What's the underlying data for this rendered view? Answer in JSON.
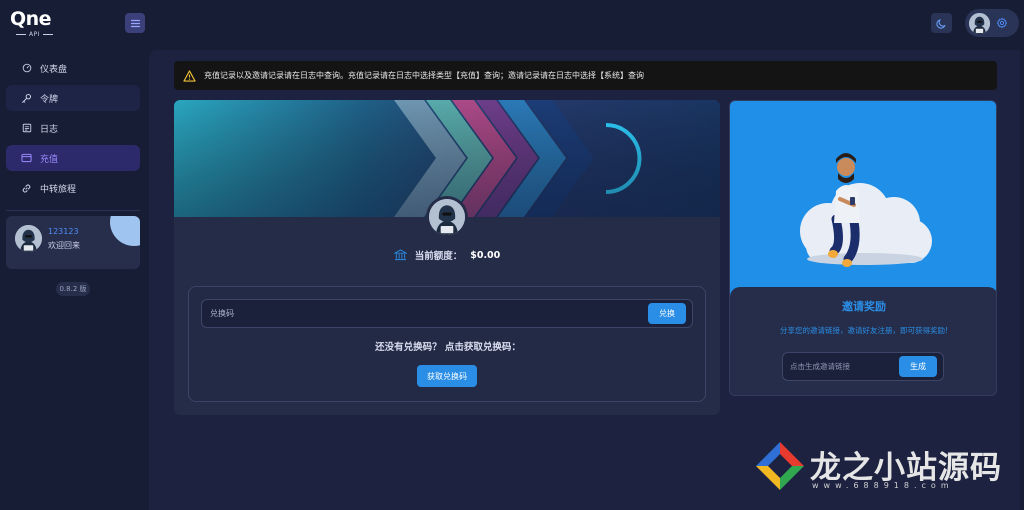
{
  "header": {
    "logo_text": "Qne",
    "logo_sub": "API",
    "menu_icon": "menu-icon",
    "theme_icon": "moon-icon",
    "settings_icon": "gear-icon"
  },
  "sidebar": {
    "items": [
      {
        "label": "仪表盘",
        "icon": "dashboard-icon"
      },
      {
        "label": "令牌",
        "icon": "key-icon"
      },
      {
        "label": "日志",
        "icon": "log-icon"
      },
      {
        "label": "充值",
        "icon": "wallet-icon"
      },
      {
        "label": "中转旅程",
        "icon": "link-icon"
      }
    ],
    "active_index": 3,
    "user": {
      "name": "123123",
      "welcome": "欢迎回来"
    },
    "version": "0.8.2 版"
  },
  "notice": {
    "text": "充值记录以及邀请记录请在日志中查询。充值记录请在日志中选择类型【充值】查询；邀请记录请在日志中选择【系统】查询",
    "icon": "warning-icon"
  },
  "redeem": {
    "quota_label": "当前额度：",
    "quota_value": "$0.00",
    "quota_icon": "bank-icon",
    "code_placeholder": "兑换码",
    "redeem_button": "兑换",
    "no_code_text": "还没有兑换码？ 点击获取兑换码：",
    "get_code_button": "获取兑换码"
  },
  "invite": {
    "title": "邀请奖励",
    "description": "分享您的邀请链接，邀请好友注册，即可获得奖励!",
    "link_placeholder": "点击生成邀请链接",
    "generate_button": "生成"
  },
  "watermark": {
    "text": "龙之小站源码",
    "sub": "www.688918.com"
  },
  "colors": {
    "accent": "#2a8ee6",
    "active_nav": "#9a8cff",
    "background": "#171d35",
    "panel": "#252c48"
  }
}
